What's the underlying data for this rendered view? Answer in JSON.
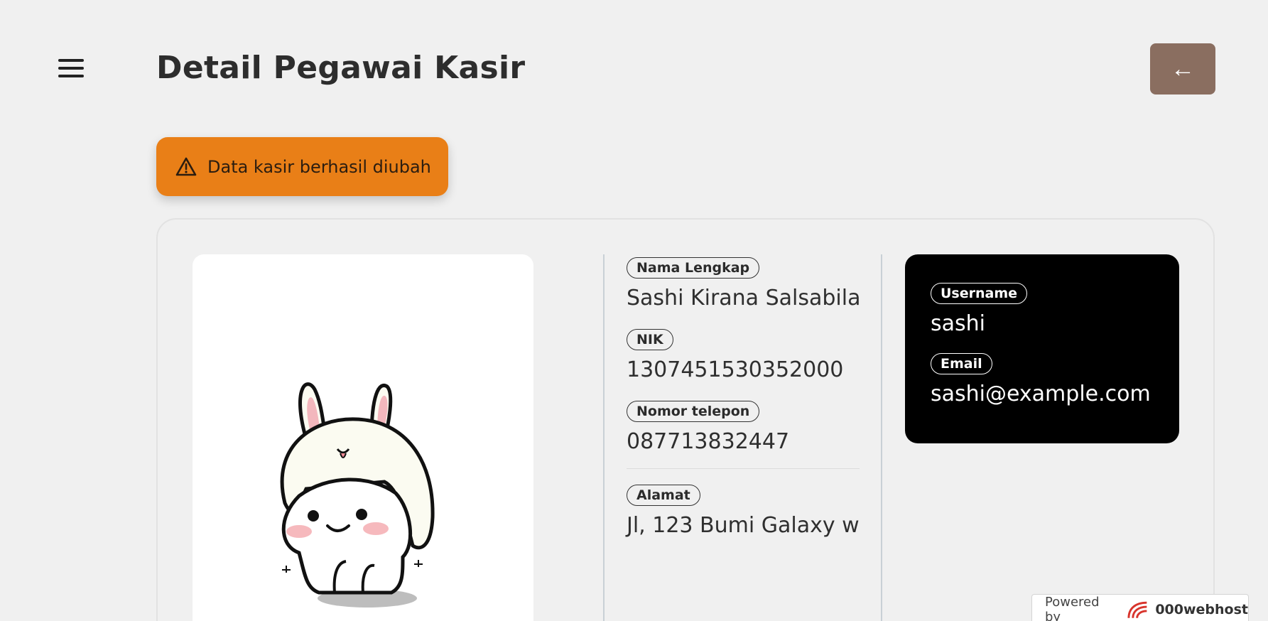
{
  "header": {
    "title": "Detail Pegawai Kasir",
    "back_label": "←"
  },
  "alert": {
    "message": "Data kasir berhasil diubah",
    "color": "#e97f17"
  },
  "details": {
    "full_name_label": "Nama Lengkap",
    "full_name": "Sashi Kirana Salsabila",
    "nik_label": "NIK",
    "nik": "1307451530352000",
    "phone_label": "Nomor telepon",
    "phone": "087713832447",
    "address_label": "Alamat",
    "address": "Jl, 123 Bumi Galaxy w"
  },
  "account": {
    "username_label": "Username",
    "username": "sashi",
    "email_label": "Email",
    "email": "sashi@example.com"
  },
  "footer": {
    "powered_by": "Powered by",
    "brand": "000webhost"
  },
  "colors": {
    "background": "#f0f0f0",
    "back_button": "#8a6e60",
    "account_box": "#000000"
  }
}
